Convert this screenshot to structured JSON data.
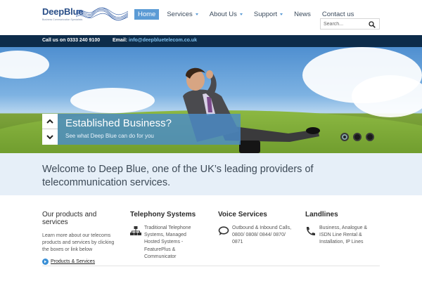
{
  "logo": {
    "name": "DeepBlue",
    "tagline": "Business Communication Specialists"
  },
  "nav": {
    "items": [
      {
        "label": "Home",
        "active": true,
        "dropdown": false
      },
      {
        "label": "Services",
        "active": false,
        "dropdown": true
      },
      {
        "label": "About Us",
        "active": false,
        "dropdown": true
      },
      {
        "label": "Support",
        "active": false,
        "dropdown": true
      },
      {
        "label": "News",
        "active": false,
        "dropdown": false
      },
      {
        "label": "Contact us",
        "active": false,
        "dropdown": false
      }
    ]
  },
  "search": {
    "placeholder": "Search..."
  },
  "contact": {
    "phone": "Call us on 0333 240 9100",
    "email_label": "Email:",
    "email": "info@deepbluetelecom.co.uk"
  },
  "hero": {
    "title": "Established Business?",
    "subtitle": "See what Deep Blue can do for you",
    "slide_count": 3,
    "active_slide": 1
  },
  "welcome": {
    "text": "Welcome to Deep Blue, one of the UK’s leading providers of telecommunication services."
  },
  "columns": {
    "products": {
      "title": "Our products and services",
      "text": "Learn more about our telecoms products and services by clicking the boxes or link below",
      "link": "Products & Services"
    },
    "telephony": {
      "title": "Telephony Systems",
      "text": "Traditional Telephone Systems, Managed Hosted Systems - FeaturePlus & Communicator",
      "icon": "network-icon"
    },
    "voice": {
      "title": "Voice Services",
      "text": "Outbound & Inbound Calls, 0800/ 0808/ 0844/ 0870/ 0871",
      "icon": "speech-bubble-icon"
    },
    "landlines": {
      "title": "Landlines",
      "text": "Business, Analogue & ISDN Line Rental & Installation, IP Lines",
      "icon": "phone-handset-icon"
    }
  },
  "colors": {
    "accent": "#5b9bd5",
    "bar": "#0d2c4a",
    "welcome_bg": "#e6eff8"
  }
}
